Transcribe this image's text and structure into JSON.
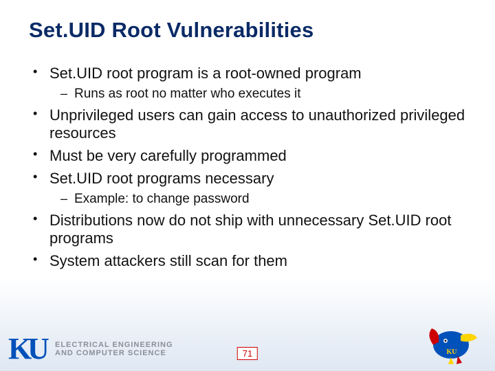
{
  "title": "Set.UID Root Vulnerabilities",
  "bullets": {
    "b1": "Set.UID root program is a root-owned program",
    "b1s1": "Runs as root no matter who executes it",
    "b2": "Unprivileged users can gain access to unauthorized privileged resources",
    "b3": "Must be very carefully programmed",
    "b4": "Set.UID root programs necessary",
    "b4s1": "Example: to change password",
    "b5": "Distributions now do not ship with unnecessary Set.UID root programs",
    "b6": "System attackers still scan for them"
  },
  "footer": {
    "dept_line1": "ELECTRICAL ENGINEERING",
    "dept_line2": "AND COMPUTER SCIENCE"
  },
  "page_number": "71"
}
